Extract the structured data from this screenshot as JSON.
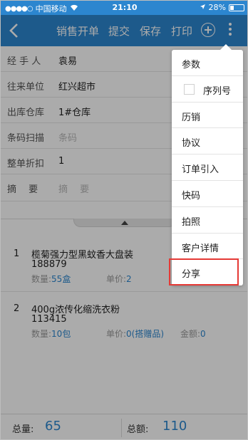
{
  "status_bar": {
    "carrier": "中国移动",
    "time": "21:10",
    "battery": "28%",
    "battery_level": 0.28
  },
  "navbar": {
    "title": "销售开单",
    "submit": "提交",
    "save": "保存",
    "print": "打印"
  },
  "form": {
    "handler_label": "经 手 人",
    "handler_value": "袁易",
    "partner_label": "往来单位",
    "partner_value": "红兴超市",
    "warehouse_label": "出库仓库",
    "warehouse_value": "1#仓库",
    "barcode_label": "条码扫描",
    "barcode_placeholder": "条码",
    "discount_label": "整单折扣",
    "discount_value": "1",
    "summary_label": "摘　 要",
    "summary_placeholder": "摘　 要"
  },
  "items": [
    {
      "index": "1",
      "name": "榄菊强力型黑蚊香大盘装",
      "code": "188879",
      "qty_label": "数量:",
      "qty_value": "55盒",
      "price_label": "单价:",
      "price_value": "2"
    },
    {
      "index": "2",
      "name": "400g浓传化缩洗衣粉",
      "code": "113415",
      "qty_label": "数量:",
      "qty_value": "10包",
      "price_label": "单价:",
      "price_value": "0(搭赠品)",
      "amount_label": "金额:",
      "amount_value": "0"
    }
  ],
  "footer": {
    "total_qty_label": "总量:",
    "total_qty_value": "65",
    "total_amount_label": "总额:",
    "total_amount_value": "110"
  },
  "menu": {
    "items": [
      "参数",
      "序列号",
      "历销",
      "协议",
      "订单引入",
      "快码",
      "拍照",
      "客户详情",
      "分享"
    ]
  },
  "colors": {
    "accent": "#2c86cf",
    "highlight": "#e53935"
  }
}
